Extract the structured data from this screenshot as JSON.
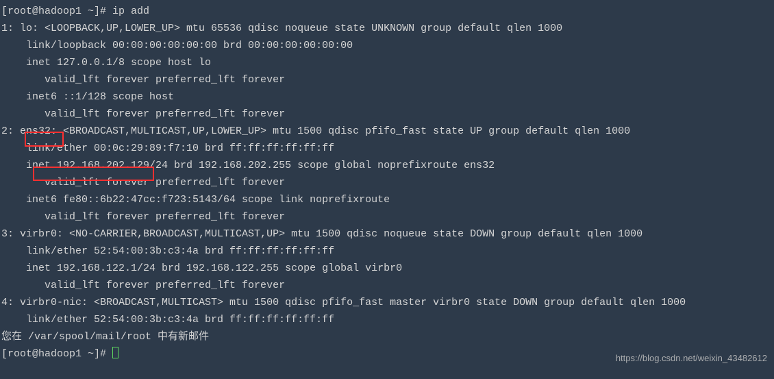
{
  "terminal": {
    "prompt1": "[root@hadoop1 ~]# ip add",
    "lines": [
      "1: lo: <LOOPBACK,UP,LOWER_UP> mtu 65536 qdisc noqueue state UNKNOWN group default qlen 1000",
      "    link/loopback 00:00:00:00:00:00 brd 00:00:00:00:00:00",
      "    inet 127.0.0.1/8 scope host lo",
      "       valid_lft forever preferred_lft forever",
      "    inet6 ::1/128 scope host",
      "       valid_lft forever preferred_lft forever",
      "2: ens32: <BROADCAST,MULTICAST,UP,LOWER_UP> mtu 1500 qdisc pfifo_fast state UP group default qlen 1000",
      "    link/ether 00:0c:29:89:f7:10 brd ff:ff:ff:ff:ff:ff",
      "    inet 192.168.202.129/24 brd 192.168.202.255 scope global noprefixroute ens32",
      "       valid_lft forever preferred_lft forever",
      "    inet6 fe80::6b22:47cc:f723:5143/64 scope link noprefixroute",
      "       valid_lft forever preferred_lft forever",
      "3: virbr0: <NO-CARRIER,BROADCAST,MULTICAST,UP> mtu 1500 qdisc noqueue state DOWN group default qlen 1000",
      "    link/ether 52:54:00:3b:c3:4a brd ff:ff:ff:ff:ff:ff",
      "    inet 192.168.122.1/24 brd 192.168.122.255 scope global virbr0",
      "       valid_lft forever preferred_lft forever",
      "4: virbr0-nic: <BROADCAST,MULTICAST> mtu 1500 qdisc pfifo_fast master virbr0 state DOWN group default qlen 1000",
      "    link/ether 52:54:00:3b:c3:4a brd ff:ff:ff:ff:ff:ff"
    ],
    "mail_notice": "您在 /var/spool/mail/root 中有新邮件",
    "prompt2": "[root@hadoop1 ~]# "
  },
  "highlights": {
    "interface_name": "ens32:",
    "inet_address": "inet 192.168.202.129"
  },
  "watermark": "https://blog.csdn.net/weixin_43482612"
}
